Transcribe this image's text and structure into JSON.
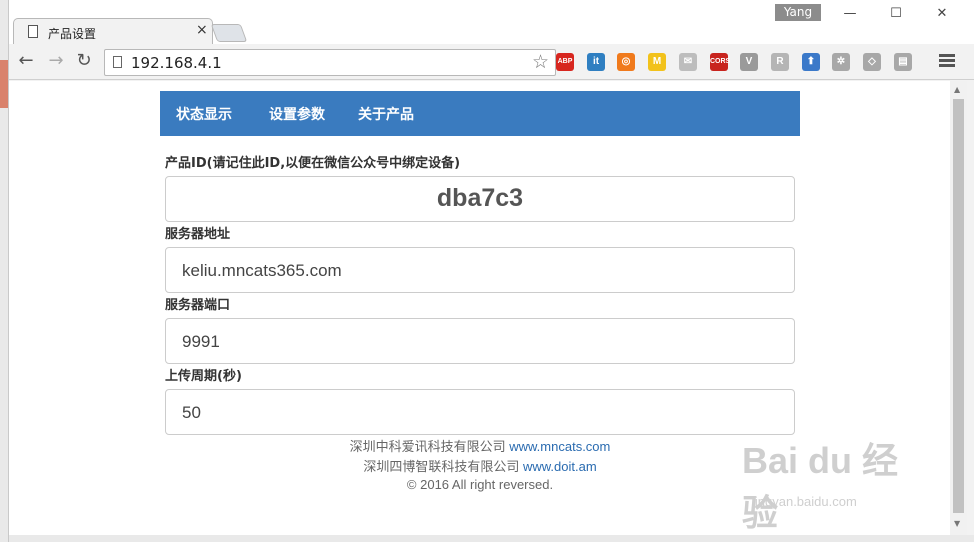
{
  "browser": {
    "tab_title": "产品设置",
    "tab_close": "×",
    "profile_name": "Yang",
    "window_controls": {
      "minimize": "—",
      "maximize": "☐",
      "close": "✕"
    },
    "url": "192.168.4.1",
    "nav": {
      "back": "←",
      "forward": "→",
      "reload": "↻"
    },
    "bookmark_star": "☆",
    "extensions": [
      {
        "name": "adblock-plus-icon",
        "label": "ABP",
        "color": "#d7261f"
      },
      {
        "name": "instapaper-it-icon",
        "label": "it",
        "color": "#2f7fc1"
      },
      {
        "name": "lifesaver-icon",
        "label": "◎",
        "color": "#f07a1c"
      },
      {
        "name": "m-extension-icon",
        "label": "M",
        "color": "#f2c21b"
      },
      {
        "name": "mail-icon",
        "label": "✉",
        "color": "#bdbdbd"
      },
      {
        "name": "cors-icon",
        "label": "CORS",
        "color": "#c8241e"
      },
      {
        "name": "v-extension-icon",
        "label": "V",
        "color": "#9a9a9a"
      },
      {
        "name": "r-extension-icon",
        "label": "R",
        "color": "#b5b5b5"
      },
      {
        "name": "shield-arrow-icon",
        "label": "⬆",
        "color": "#3b79c9"
      },
      {
        "name": "gear-extension-icon",
        "label": "✲",
        "color": "#a8a8a8"
      },
      {
        "name": "shield-outline-icon",
        "label": "◇",
        "color": "#a8a8a8"
      },
      {
        "name": "layout-icon",
        "label": "▤",
        "color": "#a8a8a8"
      }
    ]
  },
  "page": {
    "nav": [
      "状态显示",
      "设置参数",
      "关于产品"
    ],
    "fields": [
      {
        "label": "产品ID(请记住此ID,以便在微信公众号中绑定设备)",
        "value": "dba7c3"
      },
      {
        "label": "服务器地址",
        "value": "keliu.mncats365.com"
      },
      {
        "label": "服务器端口",
        "value": "9991"
      },
      {
        "label": "上传周期(秒)",
        "value": "50"
      }
    ],
    "footer": {
      "line1_text": "深圳中科爱讯科技有限公司 ",
      "line1_link": "www.mncats.com",
      "line2_text": "深圳四博智联科技有限公司 ",
      "line2_link": "www.doit.am",
      "copyright": "© 2016 All right reversed."
    }
  },
  "watermark": {
    "text": "Bai du 经验",
    "sub": "jingyan.baidu.com"
  }
}
